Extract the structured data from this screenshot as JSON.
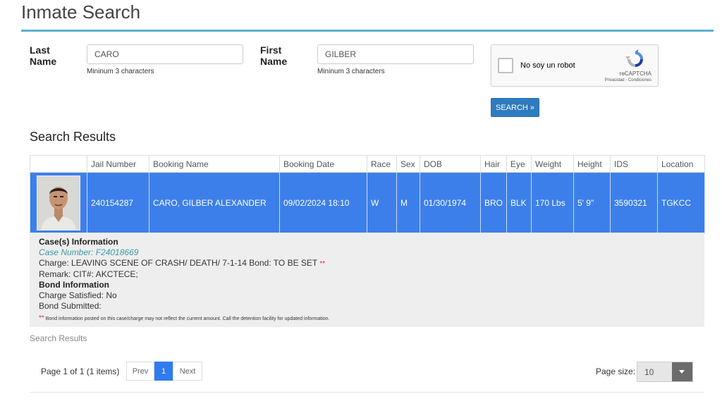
{
  "page": {
    "title": "Inmate Search"
  },
  "search": {
    "last_name_label": "Last Name",
    "last_name_value": "CARO",
    "last_name_help": "Mininum 3 characters",
    "first_name_label": "First Name",
    "first_name_value": "GILBER",
    "first_name_help": "Mininum 3 characters",
    "button_label": "SEARCH »"
  },
  "captcha": {
    "label": "No soy un robot",
    "brand": "reCAPTCHA",
    "links": "Privacidad - Condiciones",
    "logo_icon": "recaptcha-logo-icon"
  },
  "results": {
    "heading": "Search Results",
    "columns": [
      "",
      "Jail Number",
      "Booking Name",
      "Booking Date",
      "Race",
      "Sex",
      "DOB",
      "Hair",
      "Eye",
      "Weight",
      "Height",
      "IDS",
      "Location"
    ],
    "row": {
      "photo_icon": "mugshot-photo",
      "jail_number": "240154287",
      "booking_name": "CARO, GILBER ALEXANDER",
      "booking_date": "09/02/2024 18:10",
      "race": "W",
      "sex": "M",
      "dob": "01/30/1974",
      "hair": "BRO",
      "eye": "BLK",
      "weight": "170 Lbs",
      "height": "5' 9\"",
      "ids": "3590321",
      "location": "TGKCC"
    },
    "details": {
      "cases_heading": "Case(s) Information",
      "case_number": "Case Number: F24018669",
      "charge": "Charge: LEAVING SCENE OF CRASH/ DEATH/ 7-1-14 Bond: TO BE SET",
      "asterisks": "**",
      "remark": "Remark: CIT#: AKCTECE;",
      "bond_heading": "Bond Information",
      "charge_satisfied": "Charge Satisfied: No",
      "bond_submitted": "Bond Submitted:",
      "note": "Bond information posted on this case/charge may not reflect the current amount. Call the detention facility for updated information."
    },
    "footer_label": "Search Results"
  },
  "pager": {
    "info": "Page 1 of 1 (1 items)",
    "prev": "Prev",
    "current": "1",
    "next": "Next",
    "page_size_label": "Page size:",
    "page_size_value": "10"
  },
  "colors": {
    "accent_rule": "#5bb0d2",
    "row_highlight": "#3d7fea",
    "button_primary": "#2f7bbf"
  }
}
